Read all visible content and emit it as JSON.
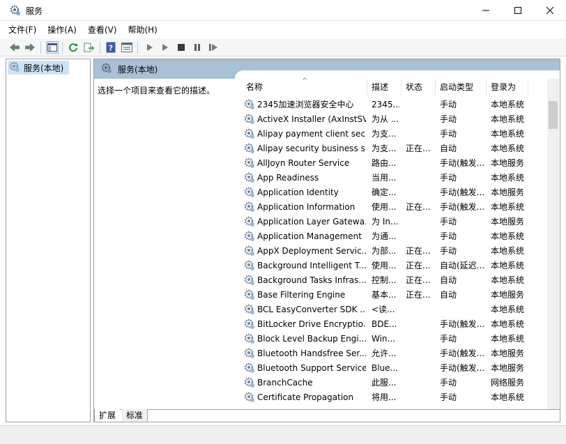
{
  "window": {
    "title": "服务"
  },
  "menu": [
    "文件(F)",
    "操作(A)",
    "查看(V)",
    "帮助(H)"
  ],
  "toolbar": {
    "icons": [
      "back-arrow-icon",
      "forward-arrow-icon",
      "show-hide-tree-icon",
      "refresh-icon",
      "export-list-icon",
      "help-icon",
      "properties-icon",
      "start-service-icon",
      "start-service-alt-icon",
      "stop-service-icon",
      "pause-service-icon",
      "restart-service-icon"
    ]
  },
  "tree": {
    "root_label": "服务(本地)"
  },
  "pane": {
    "header": "服务(本地)",
    "description": "选择一个项目来查看它的描述。"
  },
  "columns": {
    "name": "名称",
    "desc": "描述",
    "status": "状态",
    "startup": "启动类型",
    "logon": "登录为"
  },
  "rows": [
    {
      "name": "2345加速浏览器安全中心",
      "desc": "2345...",
      "status": "",
      "startup": "手动",
      "logon": "本地系统"
    },
    {
      "name": "ActiveX Installer (AxInstSV)",
      "desc": "为从 ...",
      "status": "",
      "startup": "手动",
      "logon": "本地系统"
    },
    {
      "name": "Alipay payment client sec...",
      "desc": "为支...",
      "status": "",
      "startup": "手动",
      "logon": "本地系统"
    },
    {
      "name": "Alipay security business s...",
      "desc": "为支...",
      "status": "正在...",
      "startup": "自动",
      "logon": "本地系统"
    },
    {
      "name": "AllJoyn Router Service",
      "desc": "路由...",
      "status": "",
      "startup": "手动(触发...",
      "logon": "本地服务"
    },
    {
      "name": "App Readiness",
      "desc": "当用...",
      "status": "",
      "startup": "手动",
      "logon": "本地系统"
    },
    {
      "name": "Application Identity",
      "desc": "确定...",
      "status": "",
      "startup": "手动(触发...",
      "logon": "本地服务"
    },
    {
      "name": "Application Information",
      "desc": "使用...",
      "status": "正在...",
      "startup": "手动(触发...",
      "logon": "本地系统"
    },
    {
      "name": "Application Layer Gatewa...",
      "desc": "为 In...",
      "status": "",
      "startup": "手动",
      "logon": "本地服务"
    },
    {
      "name": "Application Management",
      "desc": "为通...",
      "status": "",
      "startup": "手动",
      "logon": "本地系统"
    },
    {
      "name": "AppX Deployment Servic...",
      "desc": "为部...",
      "status": "正在...",
      "startup": "手动",
      "logon": "本地系统"
    },
    {
      "name": "Background Intelligent T...",
      "desc": "使用...",
      "status": "正在...",
      "startup": "自动(延迟...",
      "logon": "本地系统"
    },
    {
      "name": "Background Tasks Infras...",
      "desc": "控制...",
      "status": "正在...",
      "startup": "自动",
      "logon": "本地系统"
    },
    {
      "name": "Base Filtering Engine",
      "desc": "基本...",
      "status": "正在...",
      "startup": "自动",
      "logon": "本地服务"
    },
    {
      "name": "BCL EasyConverter SDK ...",
      "desc": "<读...",
      "status": "",
      "startup": "",
      "logon": "本地系统"
    },
    {
      "name": "BitLocker Drive Encryptio...",
      "desc": "BDE...",
      "status": "",
      "startup": "手动(触发...",
      "logon": "本地系统"
    },
    {
      "name": "Block Level Backup Engi...",
      "desc": "Win...",
      "status": "",
      "startup": "手动",
      "logon": "本地系统"
    },
    {
      "name": "Bluetooth Handsfree Ser...",
      "desc": "允许...",
      "status": "",
      "startup": "手动(触发...",
      "logon": "本地服务"
    },
    {
      "name": "Bluetooth Support Service",
      "desc": "Blue...",
      "status": "",
      "startup": "手动(触发...",
      "logon": "本地服务"
    },
    {
      "name": "BranchCache",
      "desc": "此服...",
      "status": "",
      "startup": "手动",
      "logon": "网络服务"
    },
    {
      "name": "Certificate Propagation",
      "desc": "将用...",
      "status": "",
      "startup": "手动",
      "logon": "本地系统"
    }
  ],
  "tabs": {
    "extended": "扩展",
    "standard": "标准"
  },
  "colors": {
    "header_band": "#a8c0d8",
    "selected": "#cce4f7"
  }
}
